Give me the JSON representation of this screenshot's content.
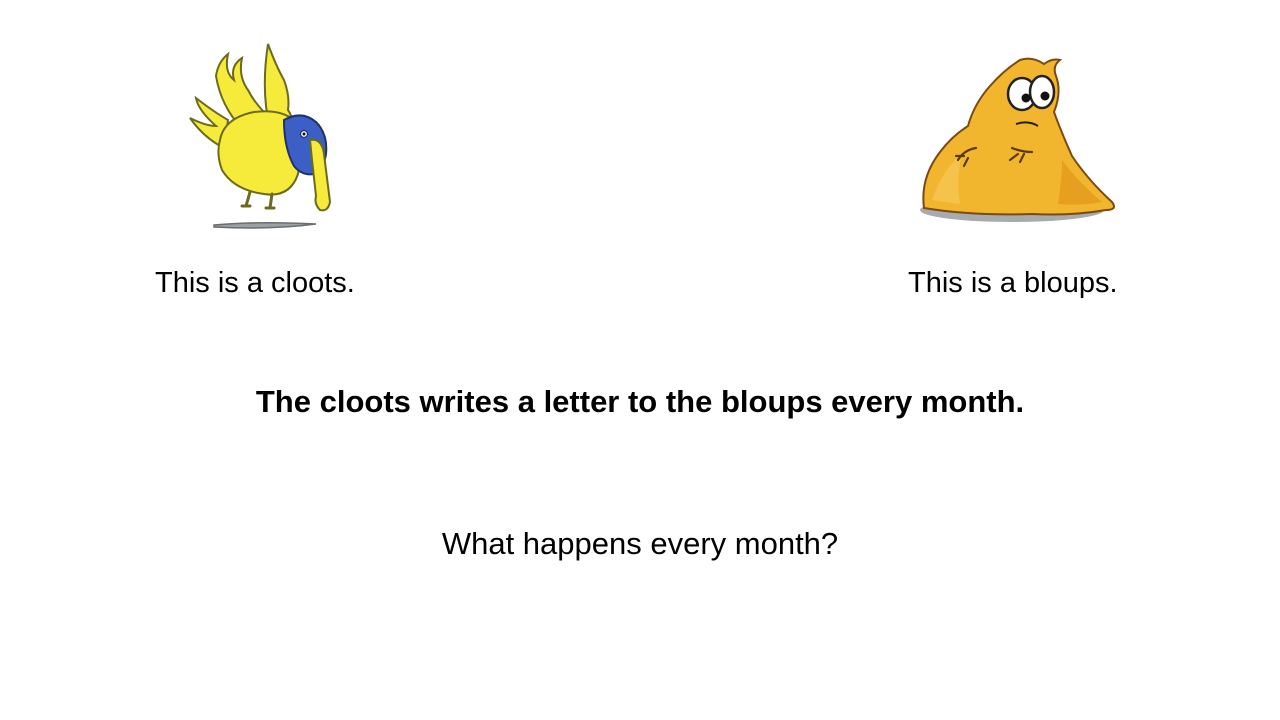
{
  "slide": {
    "cloots": {
      "icon": "yellow-bird-creature-icon",
      "caption": "This is a cloots.",
      "colors": {
        "body": "#f6ea3a",
        "accent": "#3b5fc4",
        "outline": "#6b6a1e"
      }
    },
    "bloups": {
      "icon": "orange-blob-creature-icon",
      "caption": "This is a bloups.",
      "colors": {
        "body": "#f2b52e",
        "shade": "#e39a1c",
        "shadow": "#8a8f94"
      }
    },
    "statement": "The cloots writes a letter to the bloups every month.",
    "question": "What happens every month?"
  }
}
